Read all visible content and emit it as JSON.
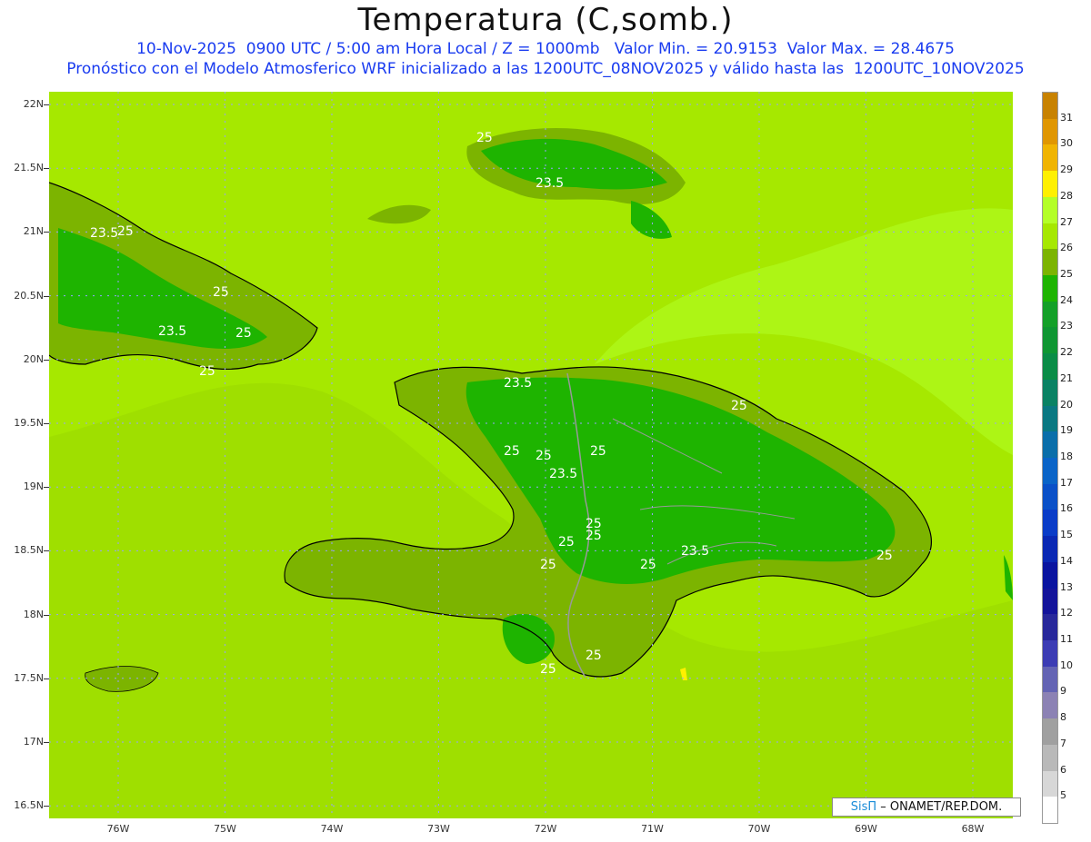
{
  "header": {
    "title": "Temperatura (C,somb.)",
    "line1": "10-Nov-2025  0900 UTC / 5:00 am Hora Local / Z = 1000mb   Valor Min. = 20.9153  Valor Max. = 28.4675",
    "line2": "Pronóstico con el Modelo Atmosferico WRF inicializado a las 1200UTC_08NOV2025 y válido hasta las  1200UTC_10NOV2025"
  },
  "axes": {
    "lat_labels": [
      "22N",
      "21.5N",
      "21N",
      "20.5N",
      "20N",
      "19.5N",
      "19N",
      "18.5N",
      "18N",
      "17.5N",
      "17N",
      "16.5N"
    ],
    "lon_labels": [
      "76W",
      "75W",
      "74W",
      "73W",
      "72W",
      "71W",
      "70W",
      "69W",
      "68W"
    ]
  },
  "colorbar": {
    "labels": [
      "31",
      "30",
      "29",
      "28",
      "27",
      "26",
      "25",
      "24",
      "23",
      "22",
      "21",
      "20",
      "19",
      "18",
      "17",
      "16",
      "15",
      "14",
      "13",
      "12",
      "11",
      "10",
      "9",
      "8",
      "7",
      "6",
      "5"
    ],
    "colors": [
      "#c88200",
      "#e09600",
      "#f0b400",
      "#fff000",
      "#b4ff28",
      "#a6e800",
      "#7cb400",
      "#1eb400",
      "#14a028",
      "#0f9632",
      "#0a8c46",
      "#0a8264",
      "#0a7882",
      "#0a6eaa",
      "#0a64c8",
      "#0a50c8",
      "#0a3cc8",
      "#0a28b4",
      "#0a14a0",
      "#14149b",
      "#28289b",
      "#3c3cb4",
      "#6464b4",
      "#8c82b4",
      "#a0a0a0",
      "#b9b9b9",
      "#d7d7d7",
      "#ffffff"
    ]
  },
  "contour_labels": [
    "25",
    "23.5",
    "25",
    "23.5",
    "25",
    "23.5",
    "25",
    "25",
    "23.5",
    "25",
    "25",
    "25",
    "25",
    "25",
    "23.5",
    "25",
    "23.5",
    "25",
    "25",
    "25",
    "25",
    "25",
    "25"
  ],
  "credit": {
    "brand": "SisΠ",
    "text": " – ONAMET/REP.DOM."
  }
}
